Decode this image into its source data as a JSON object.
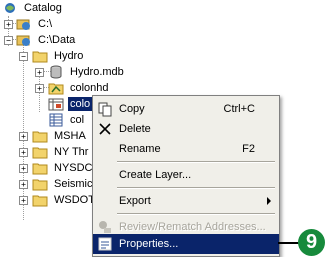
{
  "tree": {
    "catalog": "Catalog",
    "c_drive": "C:\\",
    "c_data": "C:\\Data",
    "hydro": "Hydro",
    "hydro_mdb": "Hydro.mdb",
    "colonhd": "colonhd",
    "selected_partial": "colo",
    "colo_table_partial": "col",
    "msha": "MSHA",
    "ny": "NY Thr",
    "nysdc": "NYSDC",
    "seismic": "Seismic",
    "wsdot": "WSDOT"
  },
  "context_menu": {
    "copy": "Copy",
    "copy_shortcut": "Ctrl+C",
    "delete": "Delete",
    "rename": "Rename",
    "rename_shortcut": "F2",
    "create_layer": "Create Layer...",
    "export": "Export",
    "review": "Review/Rematch Addresses...",
    "properties": "Properties..."
  },
  "callout": {
    "number": "9"
  },
  "colors": {
    "selection": "#0a246a",
    "callout": "#178a3c",
    "menu_bg": "#f0efe9"
  }
}
